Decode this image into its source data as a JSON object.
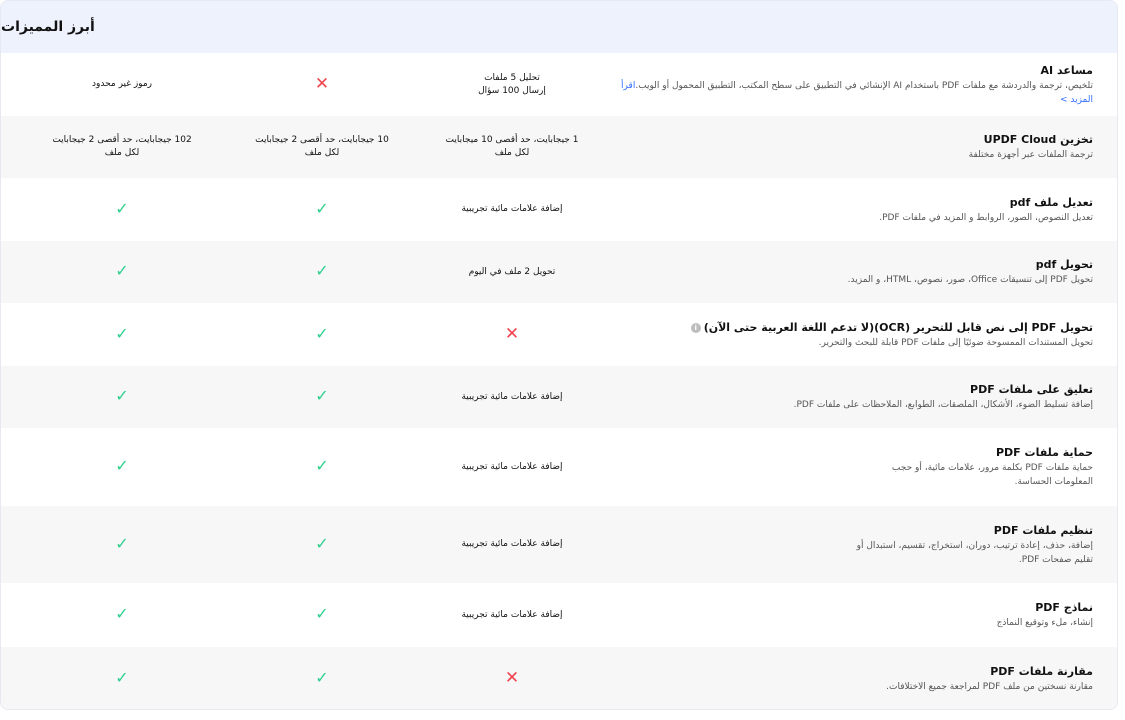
{
  "header": {
    "title": "أبرز المميزات"
  },
  "rows": [
    {
      "title": "مساعد AI",
      "desc": "تلخيص، ترجمة والدردشة مع ملفات PDF باستخدام AI الإنشائي في التطبيق على سطح المكتب، التطبيق المحمول أو الويب.",
      "more": "اقرأ المزيد >",
      "free": "تحليل 5 ملفات\nإرسال 100 سؤال",
      "mid": "cross",
      "pro": "رموز غير محدود"
    },
    {
      "title": "تخزين UPDF Cloud",
      "desc": "ترجمة الملفات عبر أجهزة مختلفة",
      "free": "1 جيجابايت، حد أقصى 10 ميجابايت\nلكل ملف",
      "mid": "10 جيجابايت، حد أقصى 2 جيجابايت\nلكل ملف",
      "pro": "102 جيجابايت، حد أقصى 2 جيجابايت\nلكل ملف"
    },
    {
      "title": "تعديل ملف pdf",
      "desc": "تعديل النصوص، الصور، الروابط و المزيد في ملفات PDF.",
      "free": "إضافة علامات مائية تجريبية",
      "mid": "check",
      "pro": "check"
    },
    {
      "title": "تحويل pdf",
      "desc": "تحويل PDF إلى تنسيقات Office، صور، نصوص، HTML، و المزيد.",
      "free": "تحويل 2 ملف في اليوم",
      "mid": "check",
      "pro": "check"
    },
    {
      "title": "تحويل PDF إلى نص قابل للتحرير (OCR)(لا تدعم اللغة العربية حتى الآن)",
      "desc": "تحويل المستندات الممسوحة ضوئيًا إلى ملفات PDF قابلة للبحث والتحرير.",
      "info": "i",
      "free": "cross",
      "mid": "check",
      "pro": "check"
    },
    {
      "title": "تعليق على ملفات PDF",
      "desc": "إضافة تسليط الضوء، الأشكال، الملصقات، الطوابع، الملاحظات على ملفات PDF.",
      "free": "إضافة علامات مائية تجريبية",
      "mid": "check",
      "pro": "check"
    },
    {
      "title": "حماية ملفات PDF",
      "desc": "حماية ملفات PDF بكلمة مرور، علامات مائية، أو حجب\nالمعلومات الحساسة.",
      "free": "إضافة علامات مائية تجريبية",
      "mid": "check",
      "pro": "check"
    },
    {
      "title": "تنظيم ملفات PDF",
      "desc": "إضافة، حذف، إعادة ترتيب، دوران، استخراج، تقسيم، استبدال أو\nتقليم صفحات PDF.",
      "free": "إضافة علامات مائية تجريبية",
      "mid": "check",
      "pro": "check"
    },
    {
      "title": "نماذج PDF",
      "desc": "إنشاء، ملء وتوقيع النماذج",
      "free": "إضافة علامات مائية تجريبية",
      "mid": "check",
      "pro": "check"
    },
    {
      "title": "مقارنة ملفات PDF",
      "desc": "مقارنة نسختين من ملف PDF لمراجعة جميع الاختلافات.",
      "free": "cross",
      "mid": "check",
      "pro": "check"
    }
  ]
}
